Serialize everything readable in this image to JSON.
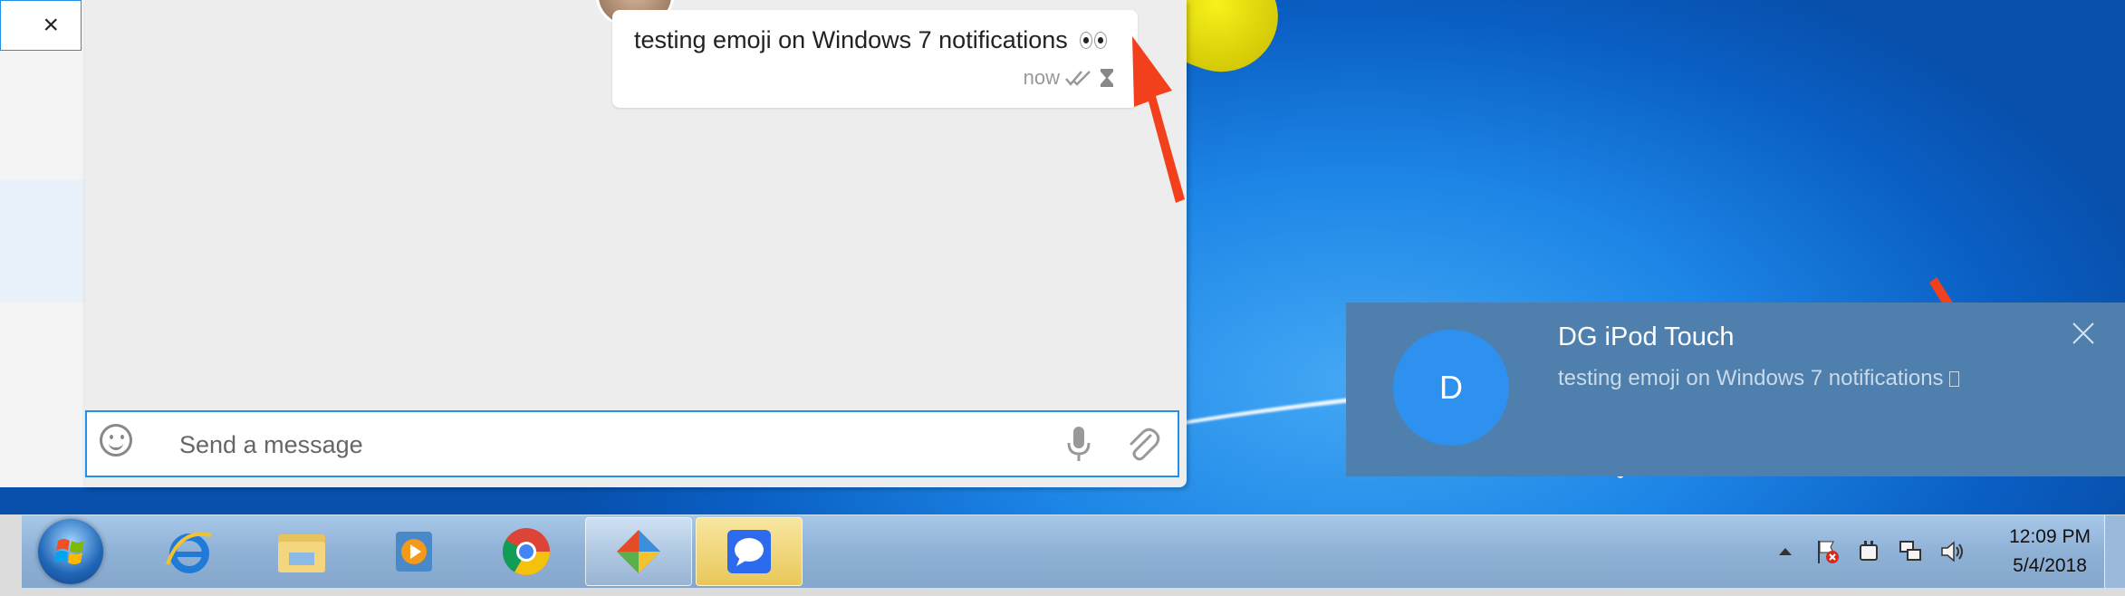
{
  "chat": {
    "message": {
      "text": "testing emoji on Windows 7 notifications",
      "time": "now"
    },
    "composer": {
      "placeholder": "Send a message"
    }
  },
  "left_panel": {
    "close_label": "×"
  },
  "notification": {
    "avatar_initial": "D",
    "title": "DG iPod Touch",
    "body": "testing emoji on Windows 7 notifications"
  },
  "taskbar": {
    "apps": [
      {
        "name": "Internet Explorer",
        "icon": "ie-icon"
      },
      {
        "name": "Windows Explorer",
        "icon": "folder-icon"
      },
      {
        "name": "Windows Media Player",
        "icon": "media-player-icon"
      },
      {
        "name": "Google Chrome",
        "icon": "chrome-icon"
      },
      {
        "name": "Git",
        "icon": "git-icon"
      },
      {
        "name": "Signal",
        "icon": "signal-icon"
      }
    ],
    "clock_time": "12:09 PM",
    "clock_date": "5/4/2018"
  },
  "colors": {
    "accent": "#2090ea",
    "toast_bg": "#4f7fad",
    "toast_avatar": "#2e90ef",
    "arrow": "#f2401c"
  }
}
